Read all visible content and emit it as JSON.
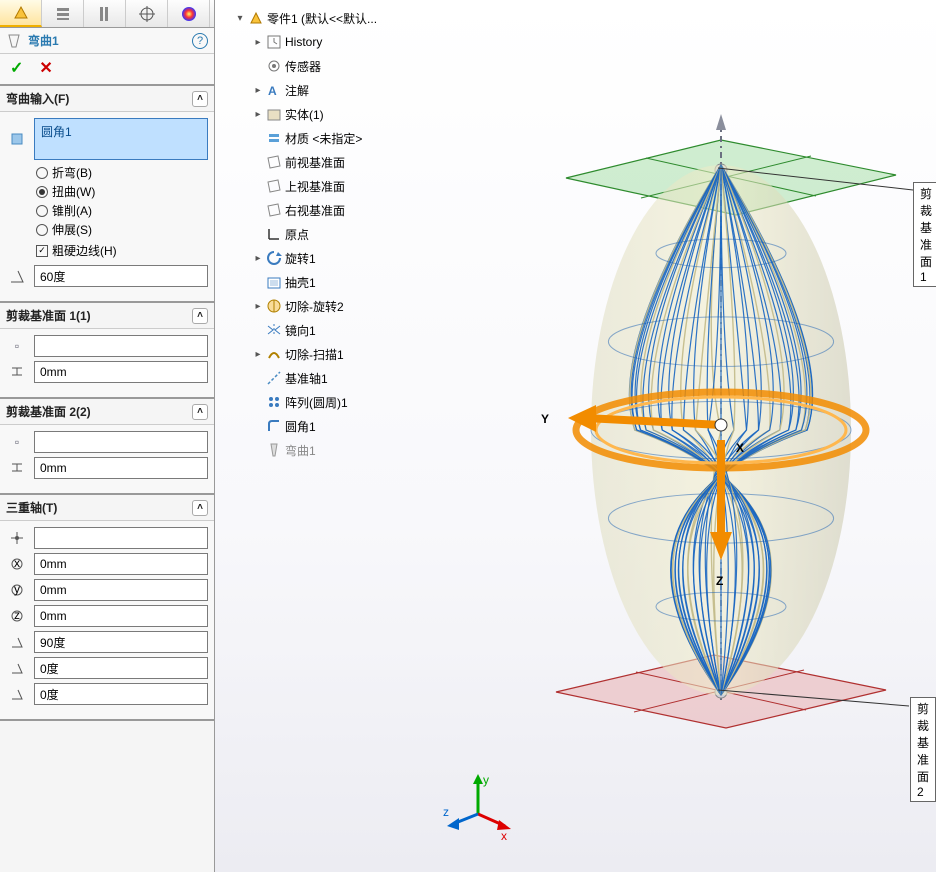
{
  "feature": {
    "name": "弯曲1"
  },
  "tabs": {
    "active": 0
  },
  "sections": {
    "input": {
      "title": "弯曲输入(F)",
      "selected": "圆角1",
      "radios": {
        "bend": "折弯(B)",
        "twist": "扭曲(W)",
        "cone": "锥削(A)",
        "stretch": "伸展(S)",
        "selected": "twist"
      },
      "hardline": {
        "label": "粗硬边线(H)",
        "checked": true
      },
      "angle": "60度"
    },
    "trim1": {
      "title": "剪裁基准面 1(1)",
      "value1": "",
      "value2": "0mm"
    },
    "trim2": {
      "title": "剪裁基准面 2(2)",
      "value1": "",
      "value2": "0mm"
    },
    "triad": {
      "title": "三重轴(T)",
      "origin": "",
      "cx": "0mm",
      "cy": "0mm",
      "cz": "0mm",
      "rx": "90度",
      "ry": "0度",
      "rz": "0度"
    }
  },
  "tree": {
    "root": "零件1  (默认<<默认...",
    "items": [
      {
        "label": "History",
        "arrow": true,
        "in": 1,
        "icon": "history"
      },
      {
        "label": "传感器",
        "arrow": false,
        "in": 1,
        "icon": "sensor"
      },
      {
        "label": "注解",
        "arrow": true,
        "in": 1,
        "icon": "annot"
      },
      {
        "label": "实体(1)",
        "arrow": true,
        "in": 1,
        "icon": "solid"
      },
      {
        "label": "材质 <未指定>",
        "arrow": false,
        "in": 1,
        "icon": "mat"
      },
      {
        "label": "前视基准面",
        "arrow": false,
        "in": 1,
        "icon": "plane"
      },
      {
        "label": "上视基准面",
        "arrow": false,
        "in": 1,
        "icon": "plane"
      },
      {
        "label": "右视基准面",
        "arrow": false,
        "in": 1,
        "icon": "plane"
      },
      {
        "label": "原点",
        "arrow": false,
        "in": 1,
        "icon": "origin"
      },
      {
        "label": "旋转1",
        "arrow": true,
        "in": 1,
        "icon": "rev"
      },
      {
        "label": "抽壳1",
        "arrow": false,
        "in": 1,
        "icon": "shell"
      },
      {
        "label": "切除-旋转2",
        "arrow": true,
        "in": 1,
        "icon": "cutrev"
      },
      {
        "label": "镜向1",
        "arrow": false,
        "in": 1,
        "icon": "mirror"
      },
      {
        "label": "切除-扫描1",
        "arrow": true,
        "in": 1,
        "icon": "cutswp"
      },
      {
        "label": "基准轴1",
        "arrow": false,
        "in": 1,
        "icon": "axis"
      },
      {
        "label": "阵列(圆周)1",
        "arrow": false,
        "in": 1,
        "icon": "pattern"
      },
      {
        "label": "圆角1",
        "arrow": false,
        "in": 1,
        "icon": "fillet"
      },
      {
        "label": "弯曲1",
        "arrow": false,
        "in": 1,
        "icon": "flex",
        "gray": true
      }
    ]
  },
  "callouts": {
    "trim1": "剪裁基准面  1",
    "trim2": "剪裁基准面  2"
  },
  "viewport_axes": {
    "x": "X",
    "y": "Y",
    "z": "Z"
  },
  "triad_axes": {
    "x": "x",
    "y": "y",
    "z": "z"
  }
}
